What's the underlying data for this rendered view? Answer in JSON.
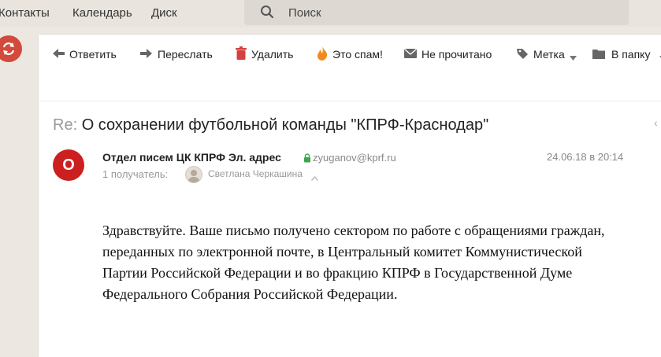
{
  "topnav": {
    "contacts": "Контакты",
    "calendar": "Календарь",
    "disk": "Диск",
    "search_placeholder": "Поиск"
  },
  "toolbar": {
    "reply": "Ответить",
    "forward": "Переслать",
    "delete": "Удалить",
    "spam": "Это спам!",
    "unread": "Не прочитано",
    "label": "Метка",
    "folder": "В папку"
  },
  "message": {
    "subject_prefix": "Re:",
    "subject": "О сохранении футбольной команды \"КПРФ-Краснодар\"",
    "avatar_letter": "О",
    "sender_name": "Отдел писем ЦК КПРФ Эл. адрес",
    "sender_email": "zyuganov@kprf.ru",
    "date": "24.06.18 в 20:14",
    "recipients_label": "1 получатель:",
    "recipient_name": "Светлана Черкашина",
    "body": " Здравствуйте. Ваше письмо получено сектором по работе с обращениями граждан, переданных по электронной почте, в Центральный комитет Коммунистической Партии Российской Федерации и во фракцию КПРФ в Государственной Думе  Федерального Собрания  Российской Федерации."
  },
  "colors": {
    "accent_red": "#cc1f1f",
    "background": "#ece8e1"
  }
}
